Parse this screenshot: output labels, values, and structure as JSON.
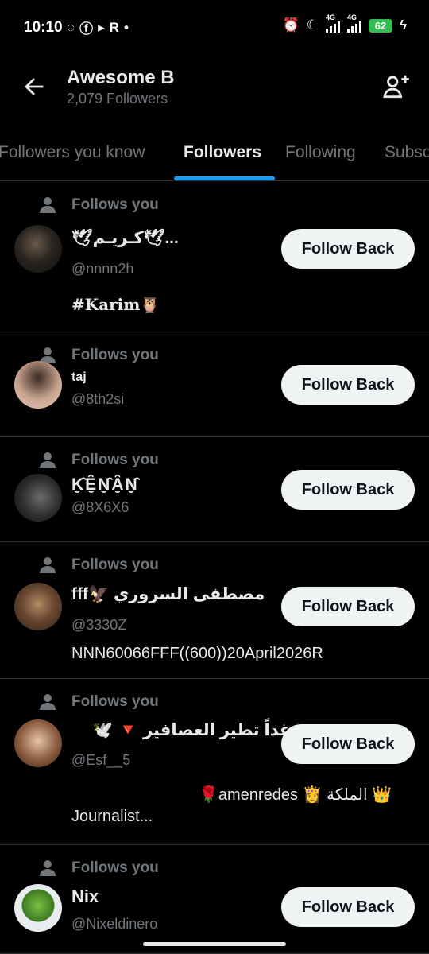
{
  "status_bar": {
    "time": "10:10",
    "battery": "62",
    "network_1": "4G",
    "network_2": "4G"
  },
  "header": {
    "title": "Awesome B",
    "subtitle": "2,079 Followers"
  },
  "tabs": [
    {
      "label": "Followers you know",
      "active": false
    },
    {
      "label": "Followers",
      "active": true
    },
    {
      "label": "Following",
      "active": false
    },
    {
      "label": "Subscriptions",
      "active": false
    }
  ],
  "colors": {
    "accent": "#1d9bf0",
    "background": "#000000",
    "muted_text": "#71767b",
    "button_bg": "#eff3f4"
  },
  "follows_you_label": "Follows you",
  "follow_back_label": "Follow Back",
  "users": [
    {
      "name": "🕊كـريـم🕊...",
      "handle": "@nnnn2h",
      "bio": "#Karim🦉",
      "bio2": ""
    },
    {
      "name": "taj",
      "handle": "@8th2si",
      "bio": "",
      "bio2": ""
    },
    {
      "name": "K̮̑Ȇ̮N̮̑Ȃ̮N̮̑",
      "handle": "@8X6X6",
      "bio": "",
      "bio2": ""
    },
    {
      "name": "fff🦅 مصطفى السروري",
      "handle": "@3330Z",
      "bio": "NNN60066FFF((600))20April2026R",
      "bio2": ""
    },
    {
      "name": "🕊️ 🔻 غداً تطير العصافير ...",
      "handle": "@Esf__5",
      "bio": "🌹amenredes 👸 الملكة 👑",
      "bio2": "Journalist..."
    },
    {
      "name": "Nix",
      "handle": "@Nixeldinero",
      "bio": "",
      "bio2": ""
    }
  ]
}
